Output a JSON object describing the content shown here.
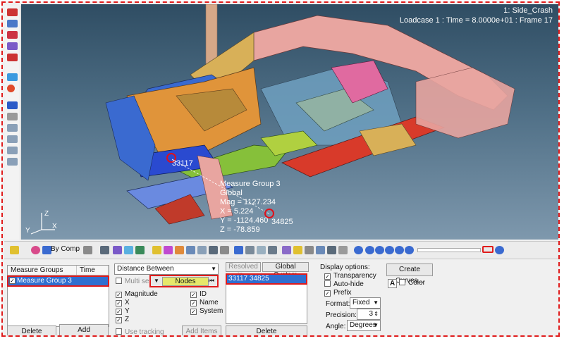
{
  "viewport": {
    "title": "1: Side_Crash",
    "loadcase": "Loadcase 1 : Time = 8.0000e+01 : Frame 17",
    "measure_label": {
      "name": "Measure Group 3",
      "system": "Global",
      "mag": "Mag = 1127.234",
      "x": "X = 5.224",
      "y": "Y = -1124.460",
      "z": "Z = -78.859"
    },
    "node_a": "33117",
    "node_b": "34825",
    "axes": {
      "x": "X",
      "y": "Y",
      "z": "Z"
    }
  },
  "toolbar": {
    "color_mode": "By Comp"
  },
  "panel": {
    "groups": {
      "col_groups": "Measure Groups",
      "col_time": "Time",
      "selected": "Measure Group 3",
      "checked": "✓",
      "delete": "Delete",
      "add": "Add"
    },
    "measure": {
      "type": "Distance Between",
      "multi_select": "Multi select",
      "entity": "Nodes",
      "opts_left": [
        "Magnitude",
        "X",
        "Y",
        "Z"
      ],
      "opts_right": [
        "ID",
        "Name",
        "System"
      ],
      "check": "✓",
      "use_tracking": "Use tracking",
      "add_items": "Add Items"
    },
    "resolved": {
      "resolved_in": "Resolved in...",
      "system": "Global System",
      "nodes": "33117 34825",
      "delete": "Delete"
    },
    "display": {
      "header": "Display options:",
      "transparency": "Transparency",
      "auto_hide": "Auto-hide",
      "prefix": "Prefix",
      "format_label": "Format:",
      "format_value": "Fixed",
      "precision_label": "Precision:",
      "precision_value": "3",
      "angle_label": "Angle:",
      "angle_value": "Degrees"
    },
    "curves": {
      "create": "Create Curves...",
      "font": "A",
      "color": "Color"
    }
  }
}
